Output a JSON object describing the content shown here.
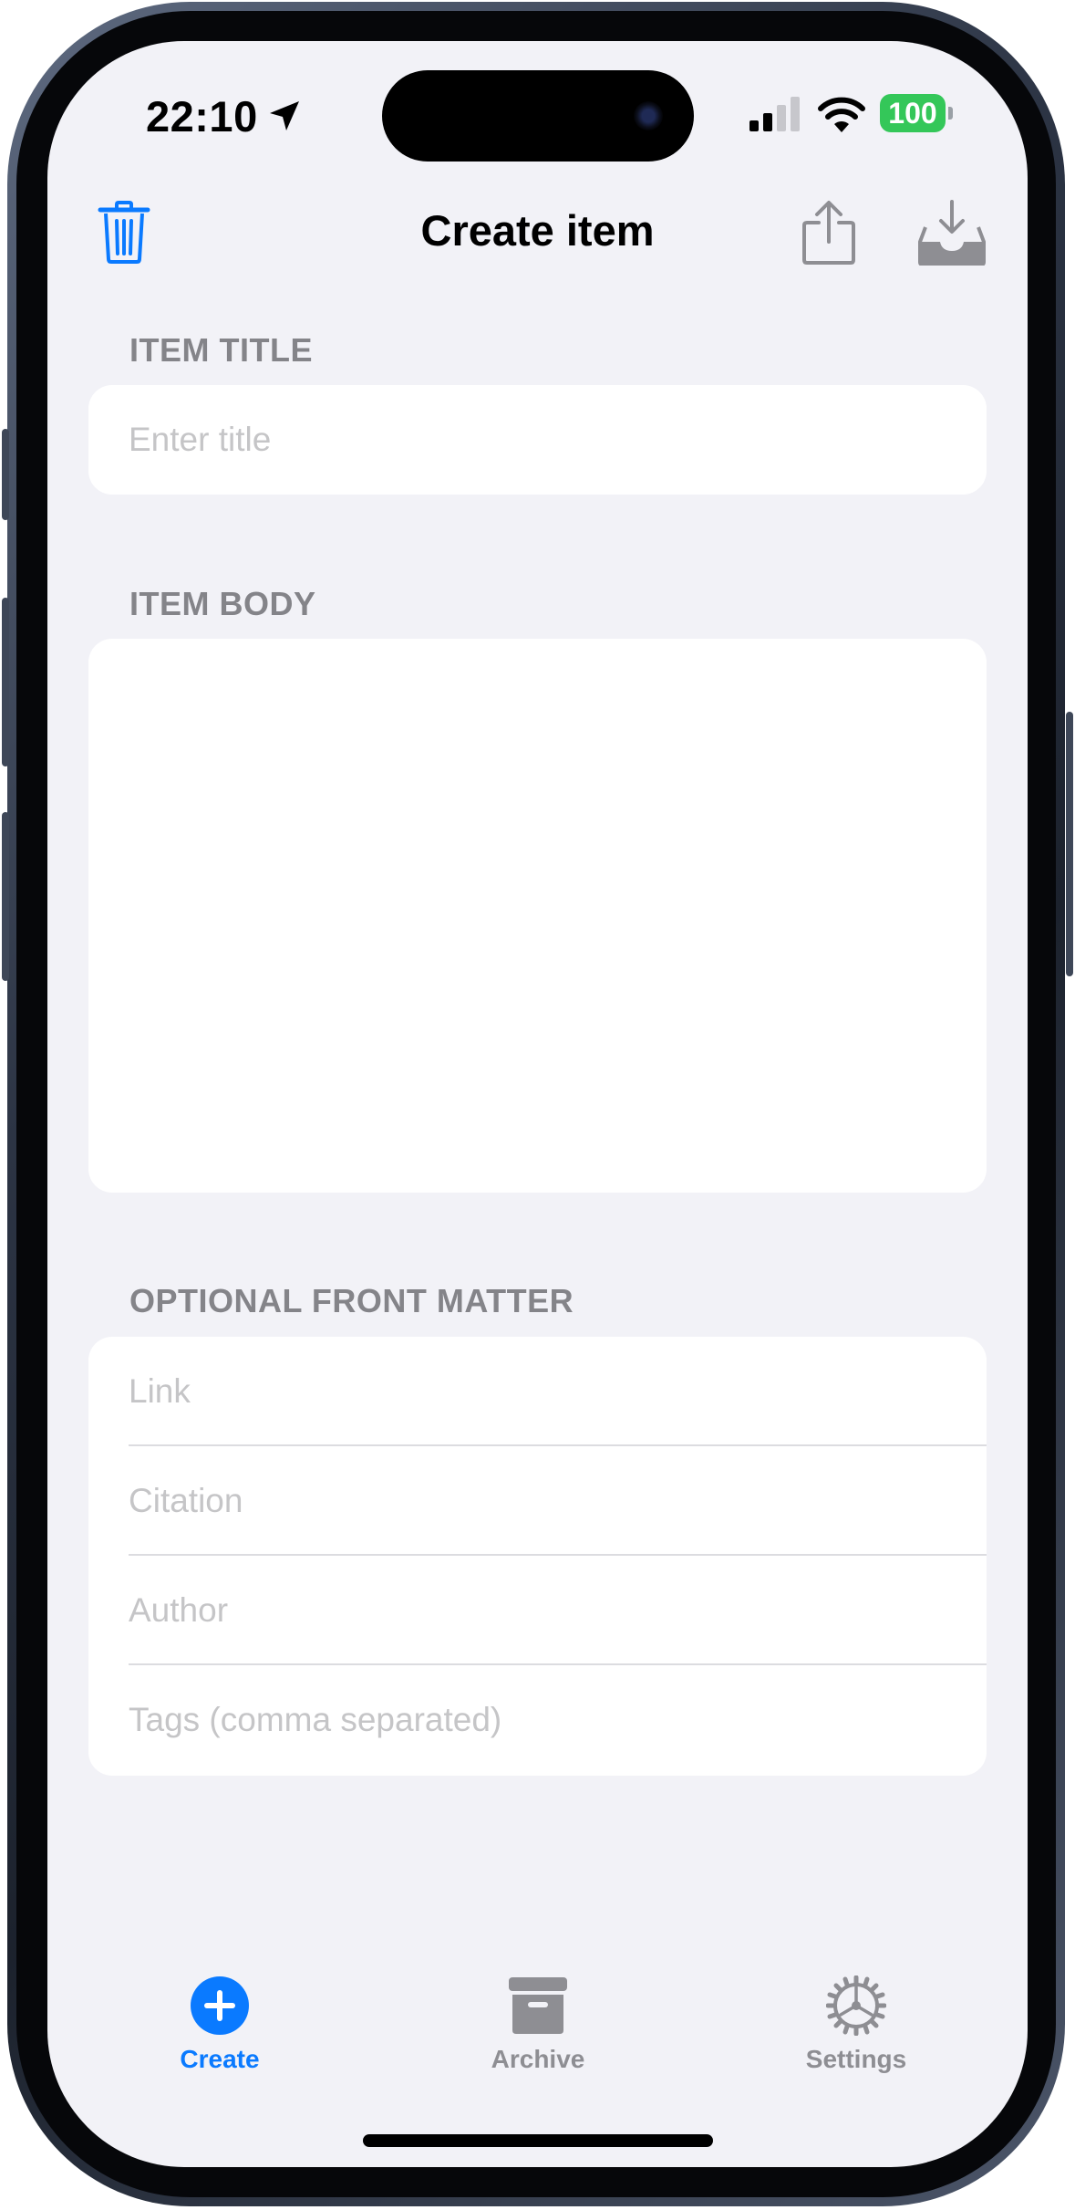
{
  "status_bar": {
    "time": "22:10",
    "battery": "100"
  },
  "nav": {
    "title": "Create item",
    "trash_icon": "trash-icon",
    "share_icon": "share-icon",
    "save_icon": "tray-arrow-down-icon"
  },
  "sections": {
    "item_title": {
      "header": "ITEM TITLE",
      "placeholder": "Enter title",
      "value": ""
    },
    "item_body": {
      "header": "ITEM BODY",
      "value": ""
    },
    "front_matter": {
      "header": "OPTIONAL FRONT MATTER",
      "fields": [
        {
          "placeholder": "Link",
          "value": ""
        },
        {
          "placeholder": "Citation",
          "value": ""
        },
        {
          "placeholder": "Author",
          "value": ""
        },
        {
          "placeholder": "Tags (comma separated)",
          "value": ""
        }
      ]
    }
  },
  "tab_bar": {
    "tabs": [
      {
        "label": "Create",
        "icon": "plus-circle-icon",
        "selected": true
      },
      {
        "label": "Archive",
        "icon": "archive-box-icon",
        "selected": false
      },
      {
        "label": "Settings",
        "icon": "gear-icon",
        "selected": false
      }
    ]
  },
  "colors": {
    "accent": "#0a7aff",
    "inactive": "#8e8e93",
    "background": "#f2f2f7",
    "battery": "#34c759"
  }
}
